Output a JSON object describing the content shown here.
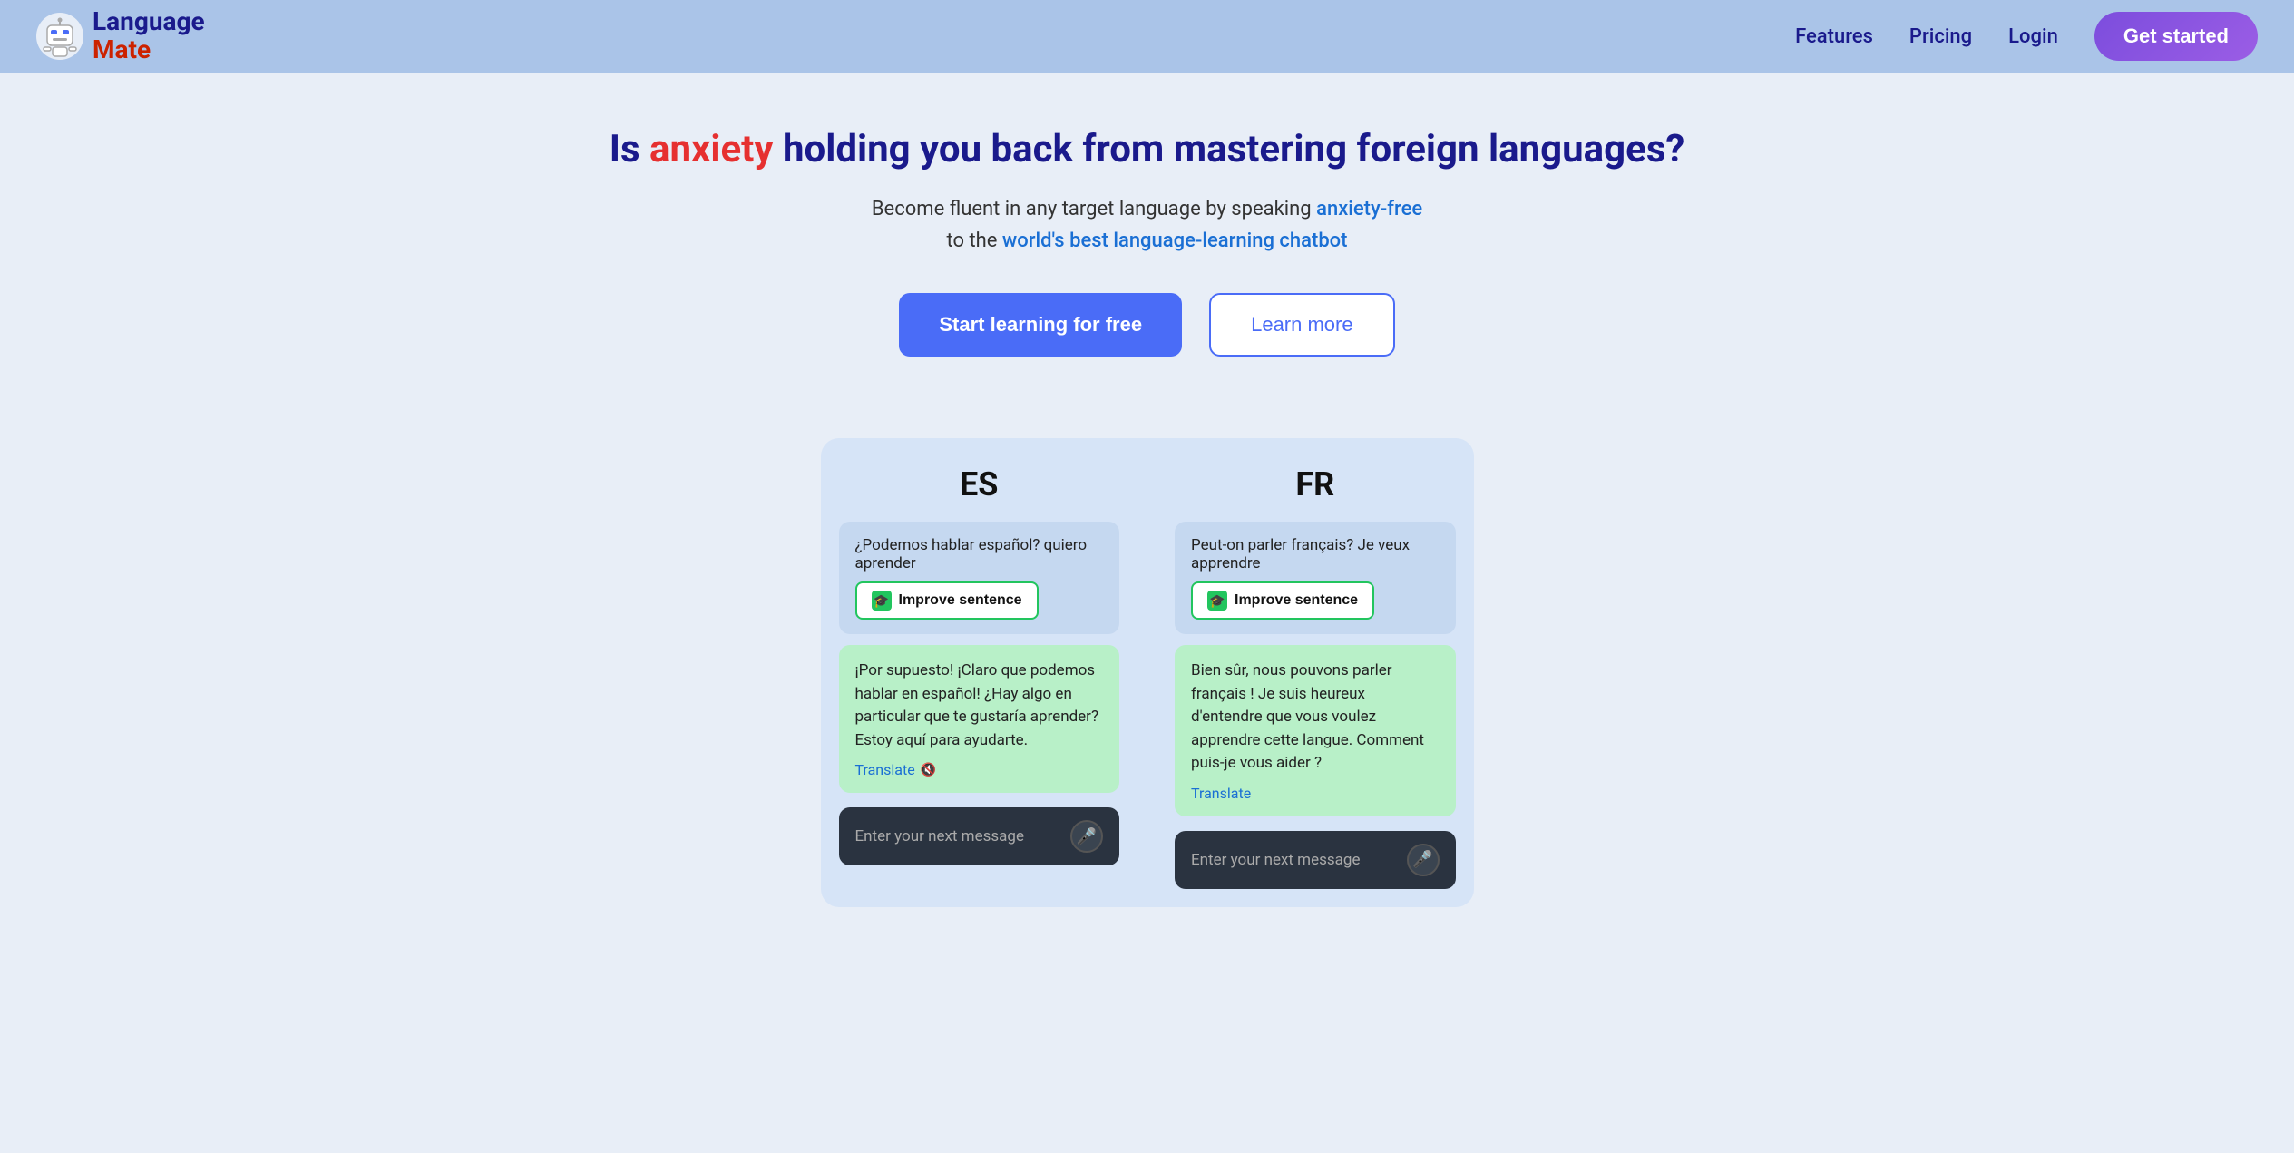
{
  "nav": {
    "logo_language": "Language",
    "logo_mate": "Mate",
    "features_label": "Features",
    "pricing_label": "Pricing",
    "login_label": "Login",
    "get_started_label": "Get started"
  },
  "hero": {
    "headline_prefix": "Is ",
    "headline_anxiety": "anxiety",
    "headline_suffix": " holding you back from mastering foreign languages?",
    "subtext_prefix": "Become fluent in any target language by speaking ",
    "subtext_anxiety_free": "anxiety-free",
    "subtext_middle": "\nto the ",
    "subtext_world_best": "world's best language-learning chatbot",
    "btn_start": "Start learning for free",
    "btn_learn": "Learn more"
  },
  "demo": {
    "es_label": "ES",
    "fr_label": "FR",
    "es_user_message": "¿Podemos hablar español? quiero aprender",
    "improve_label": "Improve sentence",
    "es_bot_message": "¡Por supuesto! ¡Claro que podemos hablar en español! ¿Hay algo en particular que te gustaría aprender? Estoy aquí para ayudarte.",
    "translate_label": "Translate",
    "fr_user_message": "Peut-on parler français? Je veux apprendre",
    "fr_bot_message": "Bien sûr, nous pouvons parler français ! Je suis heureux d'entendre que vous voulez apprendre cette langue. Comment puis-je vous aider ?",
    "fr_translate_label": "Translate",
    "input_placeholder": "Enter your next message",
    "mic_icon": "🎤"
  }
}
